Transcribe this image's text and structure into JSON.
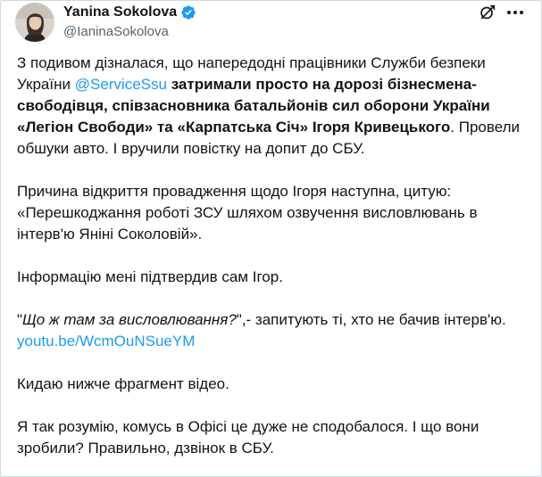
{
  "author": {
    "display_name": "Yanina Sokolova",
    "handle": "@IaninaSokolova",
    "verified": true,
    "avatar_icon": "user-avatar",
    "verified_color": "#1d9bf0"
  },
  "header_actions": {
    "grok_icon": "grok-icon",
    "more_icon": "more-dots-icon"
  },
  "tweet": {
    "p1_a": "З подивом дізналася, що напередодні працівники Служби безпеки України ",
    "p1_mention": "@ServiceSsu",
    "p1_space": " ",
    "p1_bold": "затримали просто на дорозі бізнесмена-свободівця, співзасновника батальйонів сил оборони України «Легіон Свободи» та «Карпатська Січ» Ігоря Кривецького",
    "p1_end": ". Провели обшуки авто. І вручили повістку на допит до СБУ.",
    "p2": "Причина відкриття провадження щодо Ігоря наступна, цитую: «Перешкоджання роботі ЗСУ шляхом озвучення висловлювань в інтерв'ю Яніні Соколовій».",
    "p3": "Інформацію мені підтвердив сам Ігор.",
    "p4_quote_open": "\"",
    "p4_italic": "Що ж там за висловлювання?",
    "p4_rest": "\",- запитують ті, хто не бачив інтерв'ю.",
    "p4_link": "youtu.be/WcmOuNSueYM",
    "p5": "Кидаю нижче фрагмент відео.",
    "p6": "Я так розумію, комусь в Офісі це дуже не сподобалося. І що вони зробили? Правильно, дзвінок в СБУ."
  },
  "colors": {
    "text": "#0f1419",
    "secondary": "#536471",
    "link": "#1d9bf0",
    "border": "#cfd9de"
  }
}
